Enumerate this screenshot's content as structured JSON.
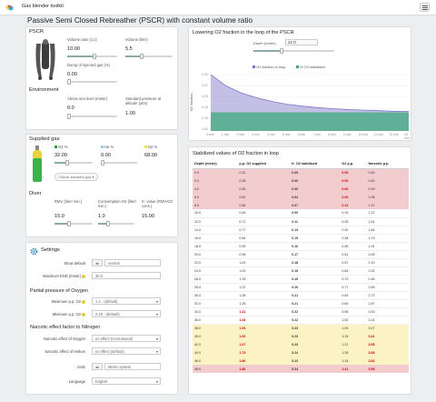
{
  "header": {
    "app_title": "Gas blender toolkit",
    "page_title": "Passive Semi Closed Rebreather (PSCR) with constant volume ratio"
  },
  "pscr": {
    "title": "PSCR",
    "volume_ratio_label": "Volume ratio (1:x)",
    "volume_ratio": "10.00",
    "volume_label": "Volume (liter)",
    "volume": "5.5",
    "dump_label": "Dump of injected gas (%)",
    "dump": "0.00"
  },
  "environment": {
    "title": "Environment",
    "above_sea_label": "Above sea level (meter)",
    "above_sea": "0.0",
    "std_pressure_label": "Standard pressure at altitude (atm)",
    "std_pressure": "1.00"
  },
  "supplied_gas": {
    "title": "Supplied gas",
    "o2_label": "O2 %",
    "he_label": "He %",
    "n2_label": "N2 %",
    "o2": "32.00",
    "he": "0.00",
    "n2": "68.00",
    "po2_button": "Critical standard gas"
  },
  "diver": {
    "title": "Diver",
    "rmv_label": "RMV (liter/ min.)",
    "rmv": "15.0",
    "consumption_label": "Consumption O2 (liter/ min.)",
    "consumption": "1.0",
    "kvalue_label": "K- value (RMV/O2 cons.)",
    "kvalue": "15.00"
  },
  "chart": {
    "title": "Lowering O2 fraction in the loop of the PSCR",
    "depth_label": "Depth (meter)",
    "depth": "21.0",
    "legend": [
      "O2 fraction in loop",
      "% O2 stabilized"
    ],
    "ylabel": "O2 fraction",
    "yticks": [
      "0.31",
      "0.27",
      "0.23",
      "0.19",
      "0.15",
      "0.11"
    ],
    "xticks": [
      "0 min",
      "1 min",
      "2 min",
      "3 min",
      "4 min",
      "5 min",
      "6 min",
      "7 min",
      "8 min",
      "9 min",
      "10 min",
      "11 min",
      "13 min",
      "15 min"
    ]
  },
  "chart_data": {
    "type": "area",
    "title": "Lowering O2 fraction in the loop of the PSCR",
    "ylabel": "O2 fraction",
    "x": [
      "0 min",
      "1 min",
      "2 min",
      "3 min",
      "4 min",
      "5 min",
      "6 min",
      "7 min",
      "8 min",
      "9 min",
      "10 min",
      "11 min",
      "13 min",
      "15 min"
    ],
    "ylim": [
      0.11,
      0.31
    ],
    "series": [
      {
        "name": "O2 fraction in loop",
        "values": [
          0.31,
          0.27,
          0.245,
          0.228,
          0.215,
          0.205,
          0.198,
          0.193,
          0.189,
          0.186,
          0.184,
          0.182,
          0.18,
          0.179
        ]
      },
      {
        "name": "% O2 stabilized",
        "values": [
          0.176,
          0.176,
          0.176,
          0.176,
          0.176,
          0.176,
          0.176,
          0.176,
          0.176,
          0.176,
          0.176,
          0.176,
          0.176,
          0.176
        ]
      }
    ],
    "colors": [
      "#7d73c6",
      "#3fa97c"
    ]
  },
  "table": {
    "title": "Stabilized values of O2 fraction in loop",
    "columns": [
      "Depth (meter)",
      "p.p. O2 supplied",
      "fr. O2 stabilized",
      "O2 p.p.",
      "Narcotic p.p."
    ],
    "rows": [
      {
        "c": [
          "0.0",
          "0.32",
          "0.09",
          "0.09",
          "0.69"
        ],
        "s": "pink",
        "r": [
          0,
          0,
          0,
          1,
          0
        ]
      },
      {
        "c": [
          "2.0",
          "0.38",
          "0.00",
          "0.00",
          "0.83"
        ],
        "s": "pink",
        "r": [
          0,
          0,
          0,
          1,
          0
        ]
      },
      {
        "c": [
          "4.0",
          "0.45",
          "0.00",
          "0.00",
          "0.99"
        ],
        "s": "pink",
        "r": [
          0,
          0,
          0,
          1,
          0
        ]
      },
      {
        "c": [
          "6.0",
          "0.52",
          "0.04",
          "0.06",
          "1.08"
        ],
        "s": "pink",
        "r": [
          0,
          0,
          0,
          1,
          0
        ]
      },
      {
        "c": [
          "8.0",
          "0.58",
          "0.07",
          "0.12",
          "1.22"
        ],
        "s": "pink",
        "r": [
          0,
          0,
          0,
          1,
          0
        ]
      },
      {
        "c": [
          "10.0",
          "0.64",
          "0.09",
          "0.19",
          "1.37"
        ],
        "s": "plain",
        "r": [
          0,
          0,
          0,
          0,
          0
        ]
      },
      {
        "c": [
          "12.0",
          "0.71",
          "0.11",
          "0.25",
          "1.51"
        ],
        "s": "plain",
        "r": [
          0,
          0,
          0,
          0,
          0
        ]
      },
      {
        "c": [
          "14.0",
          "0.77",
          "0.13",
          "0.32",
          "1.64"
        ],
        "s": "plain",
        "r": [
          0,
          0,
          0,
          0,
          0
        ]
      },
      {
        "c": [
          "16.0",
          "0.84",
          "0.15",
          "0.38",
          "1.79"
        ],
        "s": "plain",
        "r": [
          0,
          0,
          0,
          0,
          0
        ]
      },
      {
        "c": [
          "18.0",
          "0.90",
          "0.16",
          "0.45",
          "1.91"
        ],
        "s": "plain",
        "r": [
          0,
          0,
          0,
          0,
          0
        ]
      },
      {
        "c": [
          "20.0",
          "0.96",
          "0.17",
          "0.51",
          "2.05"
        ],
        "s": "plain",
        "r": [
          0,
          0,
          0,
          0,
          0
        ]
      },
      {
        "c": [
          "22.0",
          "1.03",
          "0.18",
          "0.57",
          "2.19"
        ],
        "s": "plain",
        "r": [
          0,
          0,
          0,
          0,
          0
        ]
      },
      {
        "c": [
          "24.0",
          "1.09",
          "0.19",
          "0.64",
          "2.32"
        ],
        "s": "plain",
        "r": [
          0,
          0,
          0,
          0,
          0
        ]
      },
      {
        "c": [
          "26.0",
          "1.15",
          "0.19",
          "0.70",
          "2.46"
        ],
        "s": "plain",
        "r": [
          0,
          0,
          0,
          0,
          0
        ]
      },
      {
        "c": [
          "28.0",
          "1.22",
          "0.20",
          "0.77",
          "2.59"
        ],
        "s": "plain",
        "r": [
          0,
          0,
          0,
          0,
          0
        ]
      },
      {
        "c": [
          "30.0",
          "1.28",
          "0.21",
          "0.83",
          "2.73"
        ],
        "s": "plain",
        "r": [
          0,
          0,
          0,
          0,
          0
        ]
      },
      {
        "c": [
          "32.0",
          "1.35",
          "0.21",
          "0.89",
          "2.87"
        ],
        "s": "plain",
        "r": [
          0,
          0,
          0,
          0,
          0
        ]
      },
      {
        "c": [
          "34.0",
          "1.41",
          "0.22",
          "0.96",
          "3.00"
        ],
        "s": "plain",
        "r": [
          0,
          1,
          0,
          0,
          0
        ]
      },
      {
        "c": [
          "36.0",
          "1.48",
          "0.22",
          "1.02",
          "3.14"
        ],
        "s": "plain",
        "r": [
          0,
          1,
          0,
          0,
          0
        ]
      },
      {
        "c": [
          "38.0",
          "1.54",
          "0.23",
          "1.09",
          "3.27"
        ],
        "s": "yellow",
        "r": [
          0,
          1,
          0,
          0,
          0
        ]
      },
      {
        "c": [
          "40.0",
          "1.60",
          "0.23",
          "1.15",
          "3.41"
        ],
        "s": "yellow",
        "r": [
          0,
          1,
          0,
          0,
          1
        ]
      },
      {
        "c": [
          "42.0",
          "1.67",
          "0.23",
          "1.21",
          "3.55"
        ],
        "s": "yellow",
        "r": [
          0,
          1,
          0,
          0,
          1
        ]
      },
      {
        "c": [
          "44.0",
          "1.73",
          "0.24",
          "1.28",
          "3.68"
        ],
        "s": "yellow",
        "r": [
          0,
          1,
          0,
          0,
          1
        ]
      },
      {
        "c": [
          "46.0",
          "1.80",
          "0.24",
          "1.34",
          "3.82"
        ],
        "s": "yellow",
        "r": [
          0,
          1,
          0,
          0,
          1
        ]
      },
      {
        "c": [
          "48.0",
          "1.86",
          "0.24",
          "1.41",
          "3.95"
        ],
        "s": "pink",
        "r": [
          0,
          1,
          0,
          1,
          1
        ]
      }
    ]
  },
  "settings": {
    "title": "Settings",
    "show_default_label": "Show default",
    "show_default_value": "normal",
    "max_end_label": "Maximum END (meter)",
    "max_end_value": "30.0",
    "ppo2_title": "Partial pressure of Oxygen",
    "max_ppo2_label": "Maximum p.p. O2",
    "max_ppo2_value": "1.4 - (default)",
    "min_ppo2_label": "Minimum p.p. O2",
    "min_ppo2_value": "0.18 - (default)",
    "narcotic_title": "Narcotic effect factor to Nitrogen",
    "oxygen_effect_label": "Narcotic effect of Oxygen",
    "oxygen_effect_value": "no effect (recreational)",
    "helium_effect_label": "Narcotic effect of Helium",
    "helium_effect_value": "no effect (default)",
    "units_label": "Units",
    "units_value": "Metric system",
    "language_label": "Language",
    "language_value": "English"
  }
}
